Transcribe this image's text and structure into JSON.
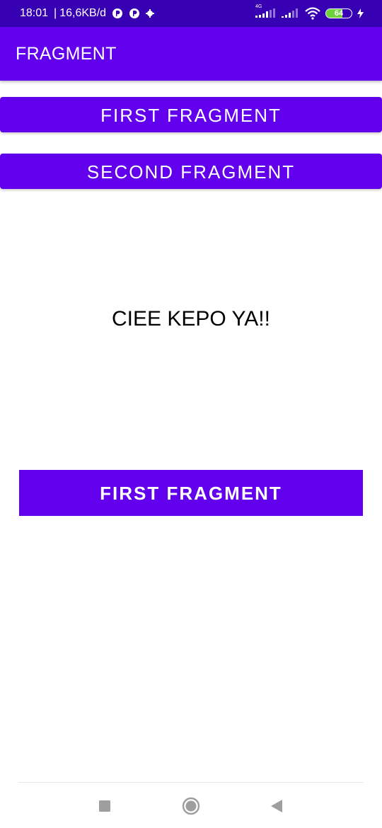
{
  "status_bar": {
    "time": "18:01",
    "separator": "|",
    "network_speed": "16,6KB/d",
    "network_type": "4G",
    "battery_level": "64",
    "battery_fraction": 0.64,
    "icons": [
      "app-notification-icon",
      "app-notification-icon-2",
      "settings-gear-icon",
      "signal-4g-icon",
      "signal-icon",
      "wifi-icon",
      "battery-icon",
      "charging-icon"
    ]
  },
  "app_bar": {
    "title": "FRAGMENT"
  },
  "buttons": {
    "first": "FIRST FRAGMENT",
    "second": "SECOND FRAGMENT"
  },
  "fragment": {
    "text": "CIEE KEPO YA!!",
    "button_label": "FIRST FRAGMENT"
  },
  "navigation": {
    "recents": "recents-icon",
    "home": "home-icon",
    "back": "back-icon"
  },
  "colors": {
    "status_bar": "#3700b3",
    "primary": "#6200ee",
    "background": "#ffffff",
    "text": "#000000",
    "nav_icon": "#9e9e9e",
    "battery_fill": "#6fd23d"
  }
}
